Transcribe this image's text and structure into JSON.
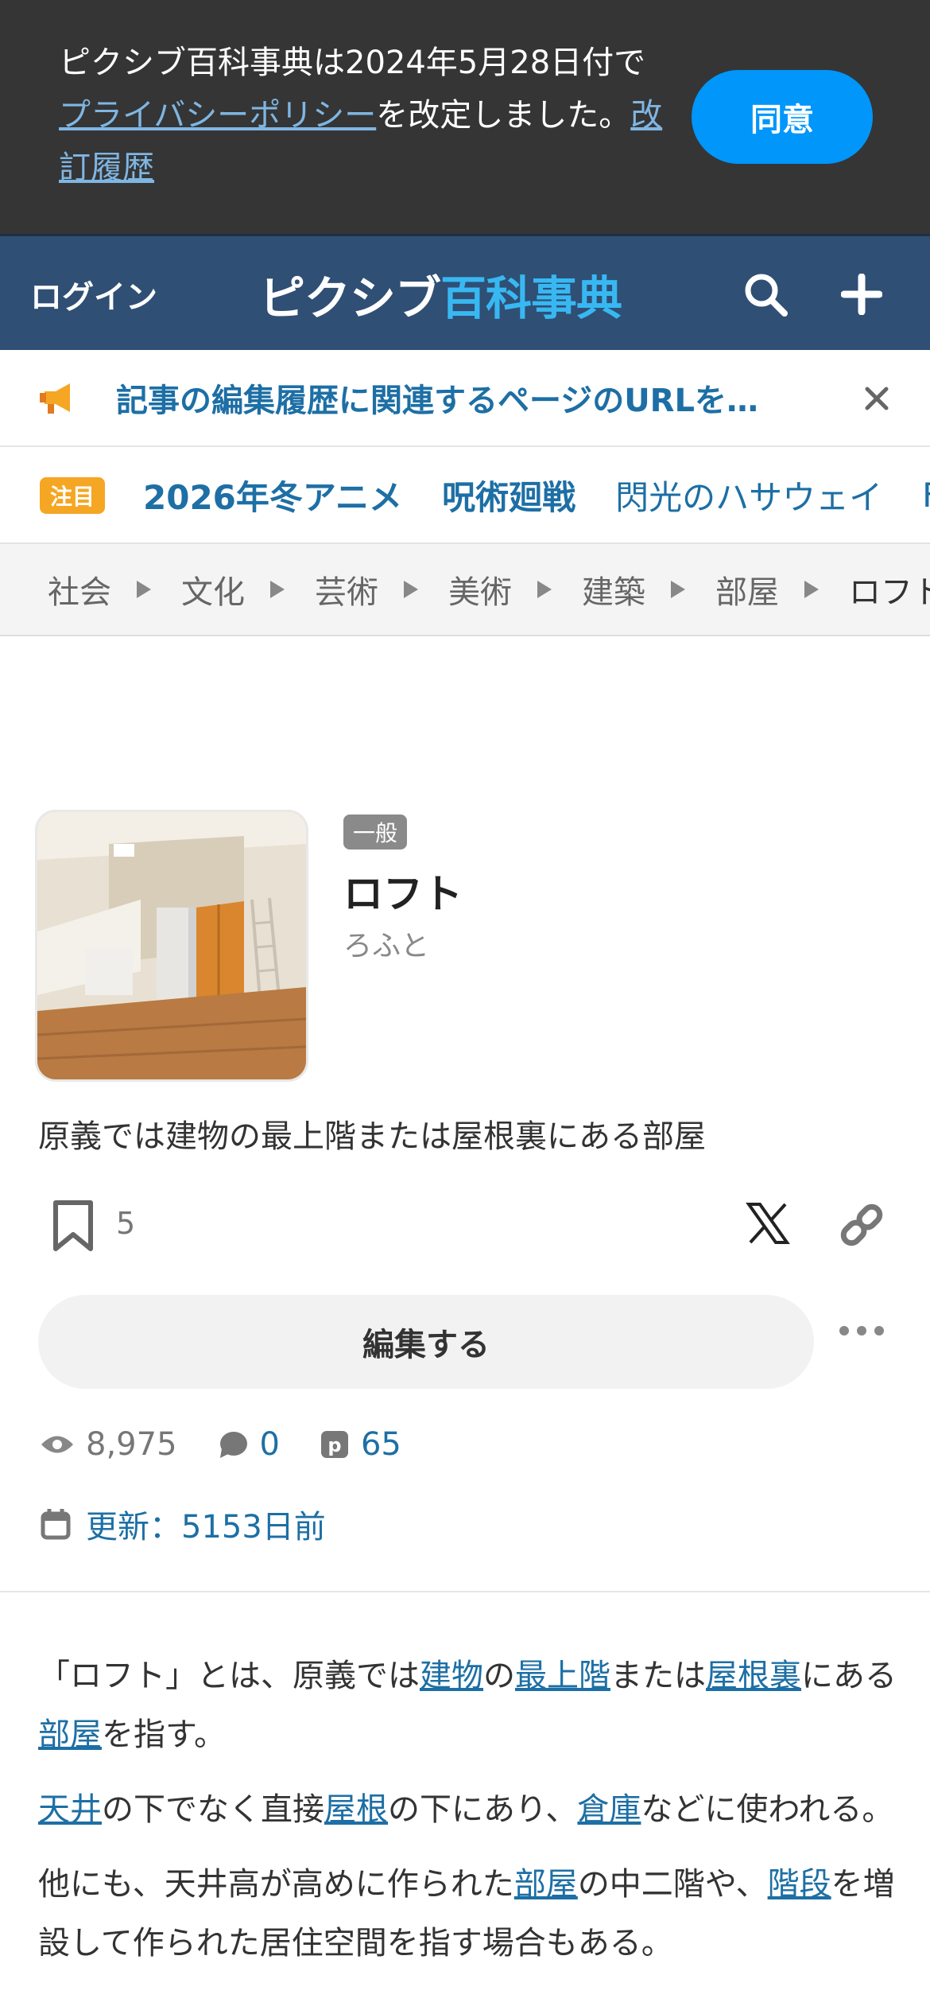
{
  "consent": {
    "text_before": "ピクシブ百科事典は2024年5月28日付で",
    "privacy_link": "プライバシーポリシー",
    "text_middle": "を改定しました。",
    "history_link": "改訂履歴",
    "agree_label": "同意"
  },
  "header": {
    "login_label": "ログイン",
    "logo_part1": "ピクシブ",
    "logo_part2": "百科事典",
    "search_icon": "search-icon",
    "add_icon": "plus-icon"
  },
  "notice": {
    "text": "記事の編集履歴に関連するページのURLを…",
    "icon": "megaphone-icon"
  },
  "trending": {
    "badge": "注目",
    "items": [
      "2026年冬アニメ",
      "呪術廻戦",
      "閃光のハサウェイ",
      "F"
    ]
  },
  "breadcrumb": {
    "items": [
      "社会",
      "文化",
      "芸術",
      "美術",
      "建築",
      "部屋"
    ],
    "current": "ロフト"
  },
  "article": {
    "category": "一般",
    "title": "ロフト",
    "reading": "ろふと",
    "summary": "原義では建物の最上階または屋根裏にある部屋",
    "bookmark_count": "5",
    "edit_label": "編集する",
    "views": "8,975",
    "comments": "0",
    "pixiv_count": "65",
    "updated": "更新：5153日前"
  },
  "body": {
    "p1": [
      "「ロフト」とは、原義では",
      "建物",
      "の",
      "最上階",
      "または",
      "屋根裏",
      "にある",
      "部屋",
      "を指す。"
    ],
    "p2": [
      "天井",
      "の下でなく直接",
      "屋根",
      "の下にあり、",
      "倉庫",
      "などに使われる。"
    ],
    "p3": [
      "他にも、天井高が高めに作られた",
      "部屋",
      "の中二階や、",
      "階段",
      "を増設して作られた居住空間を指す場合もある。"
    ]
  },
  "colors": {
    "header_bg": "#2f4f75",
    "accent": "#0096fa",
    "link": "#1d6fa5",
    "badge_hot": "#f5a623"
  }
}
